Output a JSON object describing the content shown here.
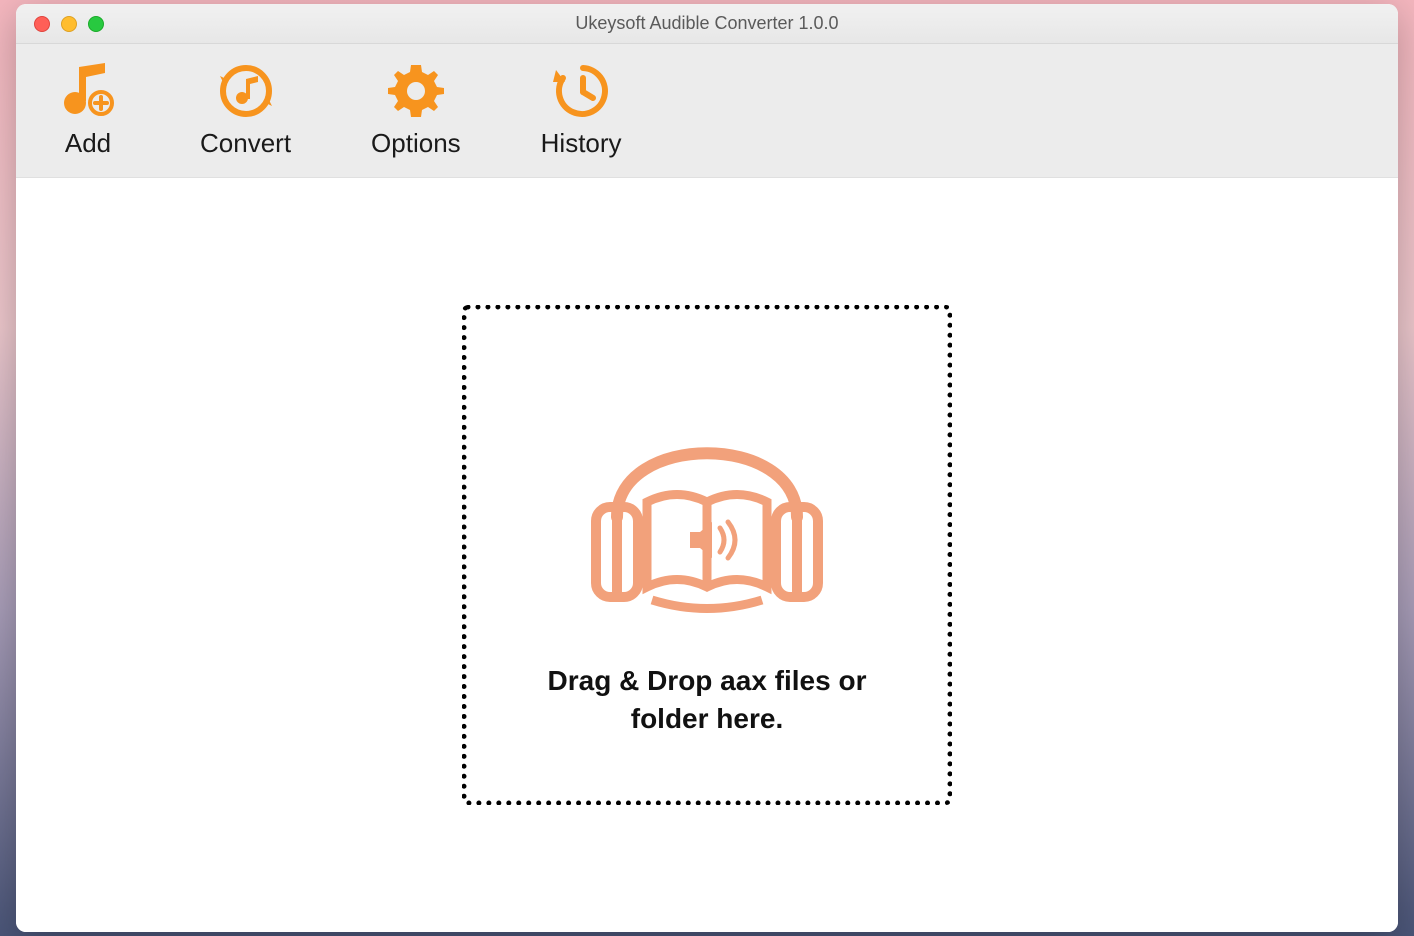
{
  "window": {
    "title": "Ukeysoft Audible Converter 1.0.0"
  },
  "toolbar": {
    "add_label": "Add",
    "convert_label": "Convert",
    "options_label": "Options",
    "history_label": "History"
  },
  "dropzone": {
    "text": "Drag & Drop aax files or folder here."
  },
  "colors": {
    "accent": "#f7941e",
    "illustration": "#f2a17b"
  }
}
